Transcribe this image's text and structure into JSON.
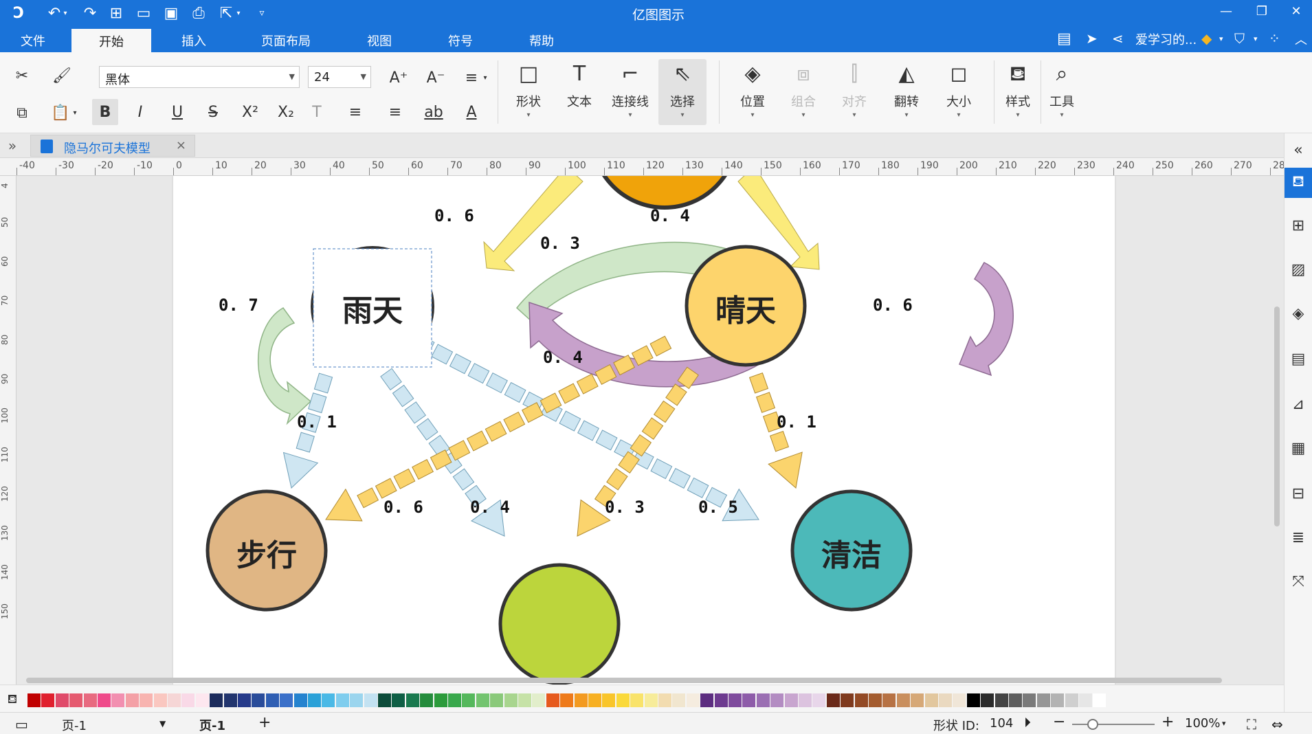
{
  "app": {
    "title": "亿图图示"
  },
  "menu": {
    "items": [
      "文件",
      "开始",
      "插入",
      "页面布局",
      "视图",
      "符号",
      "帮助"
    ],
    "active": "开始",
    "user": "爱学习的..."
  },
  "ribbon": {
    "font_family": "黑体",
    "font_size": "24",
    "buttons": {
      "shape": "形状",
      "text": "文本",
      "connector": "连接线",
      "select": "选择",
      "position": "位置",
      "group": "组合",
      "align": "对齐",
      "flip": "翻转",
      "size": "大小",
      "style": "样式",
      "tools": "工具"
    },
    "format_icons": [
      "B",
      "I",
      "U",
      "S",
      "X²",
      "X₂",
      "T",
      "≡",
      "≡",
      "ab",
      "A"
    ]
  },
  "document": {
    "tab_title": "隐马尔可夫模型",
    "close": "×"
  },
  "ruler": {
    "h_ticks": [
      "-40",
      "-30",
      "-20",
      "-10",
      "0",
      "10",
      "20",
      "30",
      "40",
      "50",
      "60",
      "70",
      "80",
      "90",
      "100",
      "110",
      "120",
      "130",
      "140",
      "150",
      "160",
      "170",
      "180",
      "190",
      "200",
      "210",
      "220",
      "230",
      "240",
      "250",
      "260",
      "270",
      "28"
    ],
    "v_ticks": [
      "4",
      "50",
      "60",
      "70",
      "80",
      "90",
      "100",
      "110",
      "120",
      "130",
      "140",
      "150"
    ]
  },
  "diagram": {
    "nodes": {
      "rain": "雨天",
      "sunny": "晴天",
      "walk": "步行",
      "clean": "清洁"
    },
    "edges": {
      "to_rain": "0. 6",
      "to_sunny": "0. 4",
      "rain_to_sunny": "0. 3",
      "sunny_to_rain": "0. 4",
      "rain_self": "0. 7",
      "sunny_self": "0. 6",
      "rain_walk": "0. 1",
      "sunny_clean": "0. 1",
      "sunny_walk": "0. 6",
      "rain_shop": "0. 4",
      "sunny_shop": "0. 3",
      "rain_clean": "0. 5"
    }
  },
  "palette": {
    "colors": [
      "#c00000",
      "#e0202e",
      "#e04b6a",
      "#e55a6f",
      "#e86a80",
      "#ef4a8a",
      "#f28fb0",
      "#f4a0a6",
      "#f8b4b0",
      "#fac7c0",
      "#f6d6d6",
      "#f9d9e7",
      "#fde7ef",
      "#1c2c5c",
      "#22356e",
      "#263a8a",
      "#2a4c9a",
      "#2f5eb3",
      "#3b70c9",
      "#2583cf",
      "#2aa1d8",
      "#4ab9e6",
      "#7fcdee",
      "#9bd5ee",
      "#c3e2f2",
      "#0d4c3a",
      "#0f5f45",
      "#1a7a4f",
      "#258c3c",
      "#2c9b3b",
      "#39a84c",
      "#55b85c",
      "#73c46f",
      "#8ac97a",
      "#a8d58e",
      "#c6e2a7",
      "#e2eecb",
      "#e65a1e",
      "#ee7a1a",
      "#f39a20",
      "#f7b022",
      "#f9c52a",
      "#fad93a",
      "#f9e36a",
      "#f7ec9a",
      "#f2dcb0",
      "#f1e6cf",
      "#f5ecdf",
      "#5c2d80",
      "#6d3a8f",
      "#7f4b9d",
      "#8e5ca9",
      "#9b6fb3",
      "#b38cc2",
      "#c8a5cf",
      "#dcc3df",
      "#e8d6ea",
      "#6b2a1a",
      "#7f3a1e",
      "#934a25",
      "#a45c2f",
      "#b77244",
      "#c98f5e",
      "#d6a877",
      "#e2c79e",
      "#ead9c0",
      "#f0e6d8",
      "#000000",
      "#2b2b2b",
      "#444444",
      "#5e5e5e",
      "#7a7a7a",
      "#969696",
      "#b3b3b3",
      "#cfcfcf",
      "#e6e6e6",
      "#ffffff"
    ]
  },
  "status": {
    "page_select": "页-1",
    "page_tab": "页-1",
    "add": "+",
    "shape_id_label": "形状 ID:",
    "shape_id": "104",
    "zoom": "100%"
  }
}
